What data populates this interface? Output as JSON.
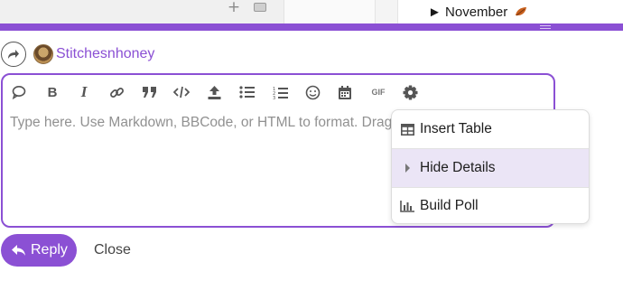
{
  "background": {
    "november_label": "November"
  },
  "composer": {
    "username": "Stitchesnhoney",
    "placeholder": "Type here. Use Markdown, BBCode, or HTML to format. Drag or paste images.",
    "toolbar": {
      "gif_label": "GIF"
    },
    "options_menu": [
      {
        "label": "Insert Table",
        "icon": "table-icon",
        "highlighted": false
      },
      {
        "label": "Hide Details",
        "icon": "caret-right-icon",
        "highlighted": true
      },
      {
        "label": "Build Poll",
        "icon": "chart-bar-icon",
        "highlighted": false
      }
    ],
    "reply_button": "Reply",
    "close_button": "Close"
  },
  "colors": {
    "accent": "#8b50d4",
    "highlight": "#ebe5f6"
  }
}
